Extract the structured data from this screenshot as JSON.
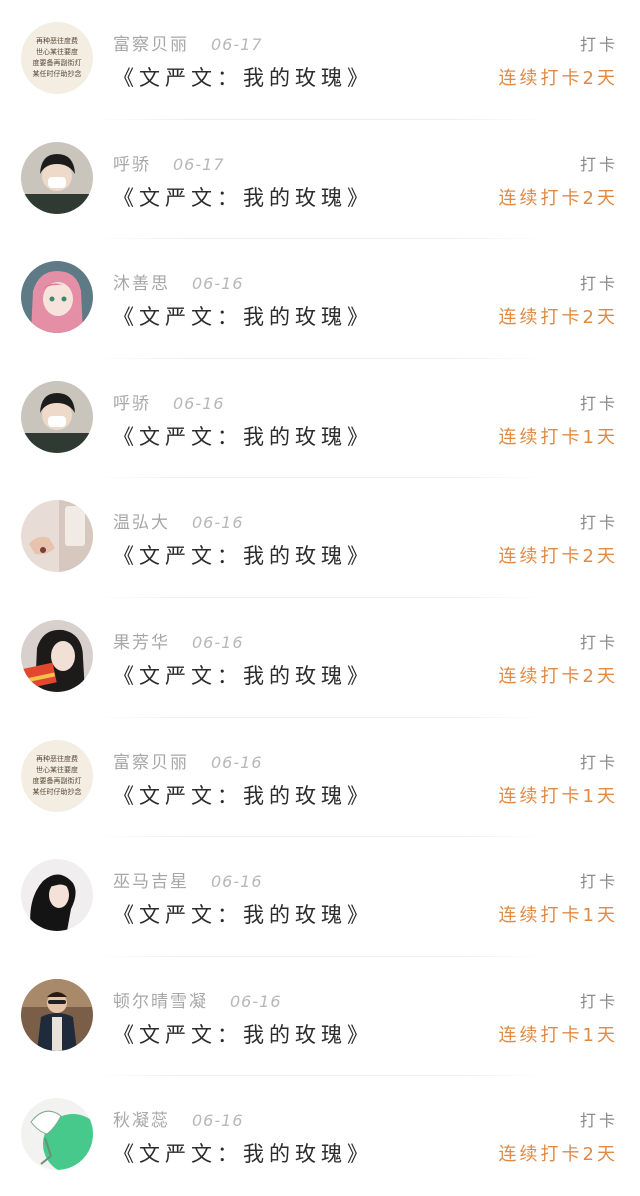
{
  "items": [
    {
      "name": "富察贝丽",
      "date": "06-17",
      "title": "《文严文：我的玫瑰》",
      "action": "打卡",
      "streak": "连续打卡2天",
      "avatar": "avatar-text-note"
    },
    {
      "name": "呼骄",
      "date": "06-17",
      "title": "《文严文：我的玫瑰》",
      "action": "打卡",
      "streak": "连续打卡2天",
      "avatar": "avatar-masked-boy"
    },
    {
      "name": "沐善思",
      "date": "06-16",
      "title": "《文严文：我的玫瑰》",
      "action": "打卡",
      "streak": "连续打卡2天",
      "avatar": "avatar-pink-hair-anime"
    },
    {
      "name": "呼骄",
      "date": "06-16",
      "title": "《文严文：我的玫瑰》",
      "action": "打卡",
      "streak": "连续打卡1天",
      "avatar": "avatar-masked-boy"
    },
    {
      "name": "温弘大",
      "date": "06-16",
      "title": "《文严文：我的玫瑰》",
      "action": "打卡",
      "streak": "连续打卡2天",
      "avatar": "avatar-hand-photo"
    },
    {
      "name": "果芳华",
      "date": "06-16",
      "title": "《文严文：我的玫瑰》",
      "action": "打卡",
      "streak": "连续打卡2天",
      "avatar": "avatar-girl-red"
    },
    {
      "name": "富察贝丽",
      "date": "06-16",
      "title": "《文严文：我的玫瑰》",
      "action": "打卡",
      "streak": "连续打卡1天",
      "avatar": "avatar-text-note"
    },
    {
      "name": "巫马吉星",
      "date": "06-16",
      "title": "《文严文：我的玫瑰》",
      "action": "打卡",
      "streak": "连续打卡1天",
      "avatar": "avatar-girl-dark-hair"
    },
    {
      "name": "顿尔晴雪凝",
      "date": "06-16",
      "title": "《文严文：我的玫瑰》",
      "action": "打卡",
      "streak": "连续打卡1天",
      "avatar": "avatar-man-jacket"
    },
    {
      "name": "秋凝蕊",
      "date": "06-16",
      "title": "《文严文：我的玫瑰》",
      "action": "打卡",
      "streak": "连续打卡2天",
      "avatar": "avatar-green-anime"
    }
  ],
  "avatar_note_text": [
    "再种恶往度费",
    "世心某往要度",
    "度要备再副街灯",
    "某任时仔助抄念"
  ]
}
